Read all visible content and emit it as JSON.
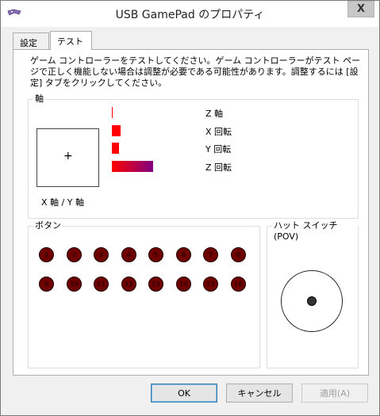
{
  "window": {
    "title": "USB GamePad のプロパティ",
    "close_glyph": "X"
  },
  "tabs": [
    {
      "label": "設定",
      "selected": false
    },
    {
      "label": "テスト",
      "selected": true
    }
  ],
  "description": "ゲーム コントローラーをテストしてください。ゲーム コントローラーがテスト ページで正しく機能しない場合は調整が必要である可能性があります。調整するには [設定] タブをクリックしてください。",
  "axes": {
    "group_label": "軸",
    "xy_label": "X 軸 / Y 軸",
    "crosshair": "+",
    "bars": [
      {
        "label": "Z 軸",
        "level": 0.02
      },
      {
        "label": "X 回転",
        "level": 0.22
      },
      {
        "label": "Y 回転",
        "level": 0.17
      },
      {
        "label": "Z 回転",
        "level": 1.0
      }
    ],
    "bar_colors": {
      "start": "#ff0000",
      "end": "#800080"
    }
  },
  "buttons": {
    "group_label": "ボタン",
    "items": [
      "1",
      "2",
      "3",
      "4",
      "5",
      "6",
      "7",
      "8",
      "9",
      "10",
      "11",
      "12",
      "13",
      "14",
      "15",
      "16"
    ],
    "fill_color": "#6e0000"
  },
  "pov": {
    "group_label": "ハット スイッチ (POV)"
  },
  "footer": {
    "ok_label": "OK",
    "cancel_label": "キャンセル",
    "apply_label": "適用(A)"
  }
}
